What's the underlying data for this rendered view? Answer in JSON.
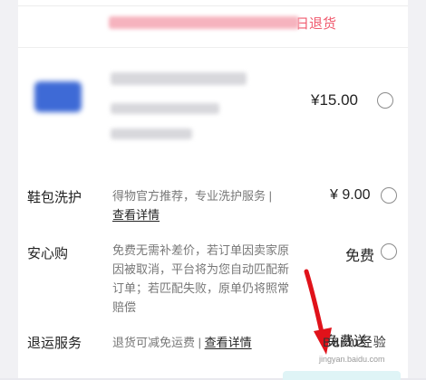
{
  "colors": {
    "accent_red": "#f05a6e",
    "arrow_red": "#e0121a"
  },
  "promo": {
    "suffix_text": "日退货"
  },
  "product": {
    "price": "¥15.00"
  },
  "services": [
    {
      "label": "鞋包洗护",
      "description": "得物官方推荐，专业洗护服务 |",
      "link": "查看详情",
      "price": "¥ 9.00"
    },
    {
      "label": "安心购",
      "description_lines": [
        "免费无需补差价，若订单因卖家原",
        "因被取消，平台将为您自动匹配新",
        "订单；若匹配失败，原单仍将照常",
        "赔偿"
      ],
      "price": "免费"
    },
    {
      "label": "退运服务",
      "description": "退货可减免运费 |",
      "link": "查看详情",
      "price": "免费送"
    }
  ],
  "watermark": {
    "text": "Baidu经验",
    "sub": "jingyan.baidu.com"
  }
}
